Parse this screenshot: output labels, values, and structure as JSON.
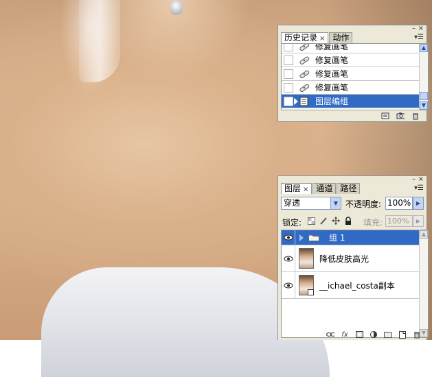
{
  "history_panel": {
    "tabs": [
      {
        "label": "历史记录",
        "active": true
      },
      {
        "label": "动作",
        "active": false
      }
    ],
    "items": [
      {
        "label": "修复画笔",
        "icon": "healing-brush-icon",
        "selected": false
      },
      {
        "label": "修复画笔",
        "icon": "healing-brush-icon",
        "selected": false
      },
      {
        "label": "修复画笔",
        "icon": "healing-brush-icon",
        "selected": false
      },
      {
        "label": "修复画笔",
        "icon": "healing-brush-icon",
        "selected": false
      },
      {
        "label": "图层编组",
        "icon": "layer-group-icon",
        "selected": true
      }
    ],
    "tab_close": "×"
  },
  "layers_panel": {
    "tabs": [
      {
        "label": "图层",
        "active": true
      },
      {
        "label": "通道",
        "active": false
      },
      {
        "label": "路径",
        "active": false
      }
    ],
    "tab_close": "×",
    "blend_mode": "穿透",
    "opacity_label": "不透明度:",
    "opacity_value": "100%",
    "lock_label": "锁定:",
    "fill_label": "填充:",
    "fill_value": "100%",
    "layers": [
      {
        "name": "组 1",
        "type": "group",
        "selected": true
      },
      {
        "name": "降低皮肤高光",
        "type": "pixel",
        "selected": false
      },
      {
        "name": "__ichael_costa副本",
        "type": "smart",
        "selected": false
      }
    ]
  },
  "colors": {
    "selection": "#316ac5",
    "panel_bg": "#ece9d8"
  }
}
